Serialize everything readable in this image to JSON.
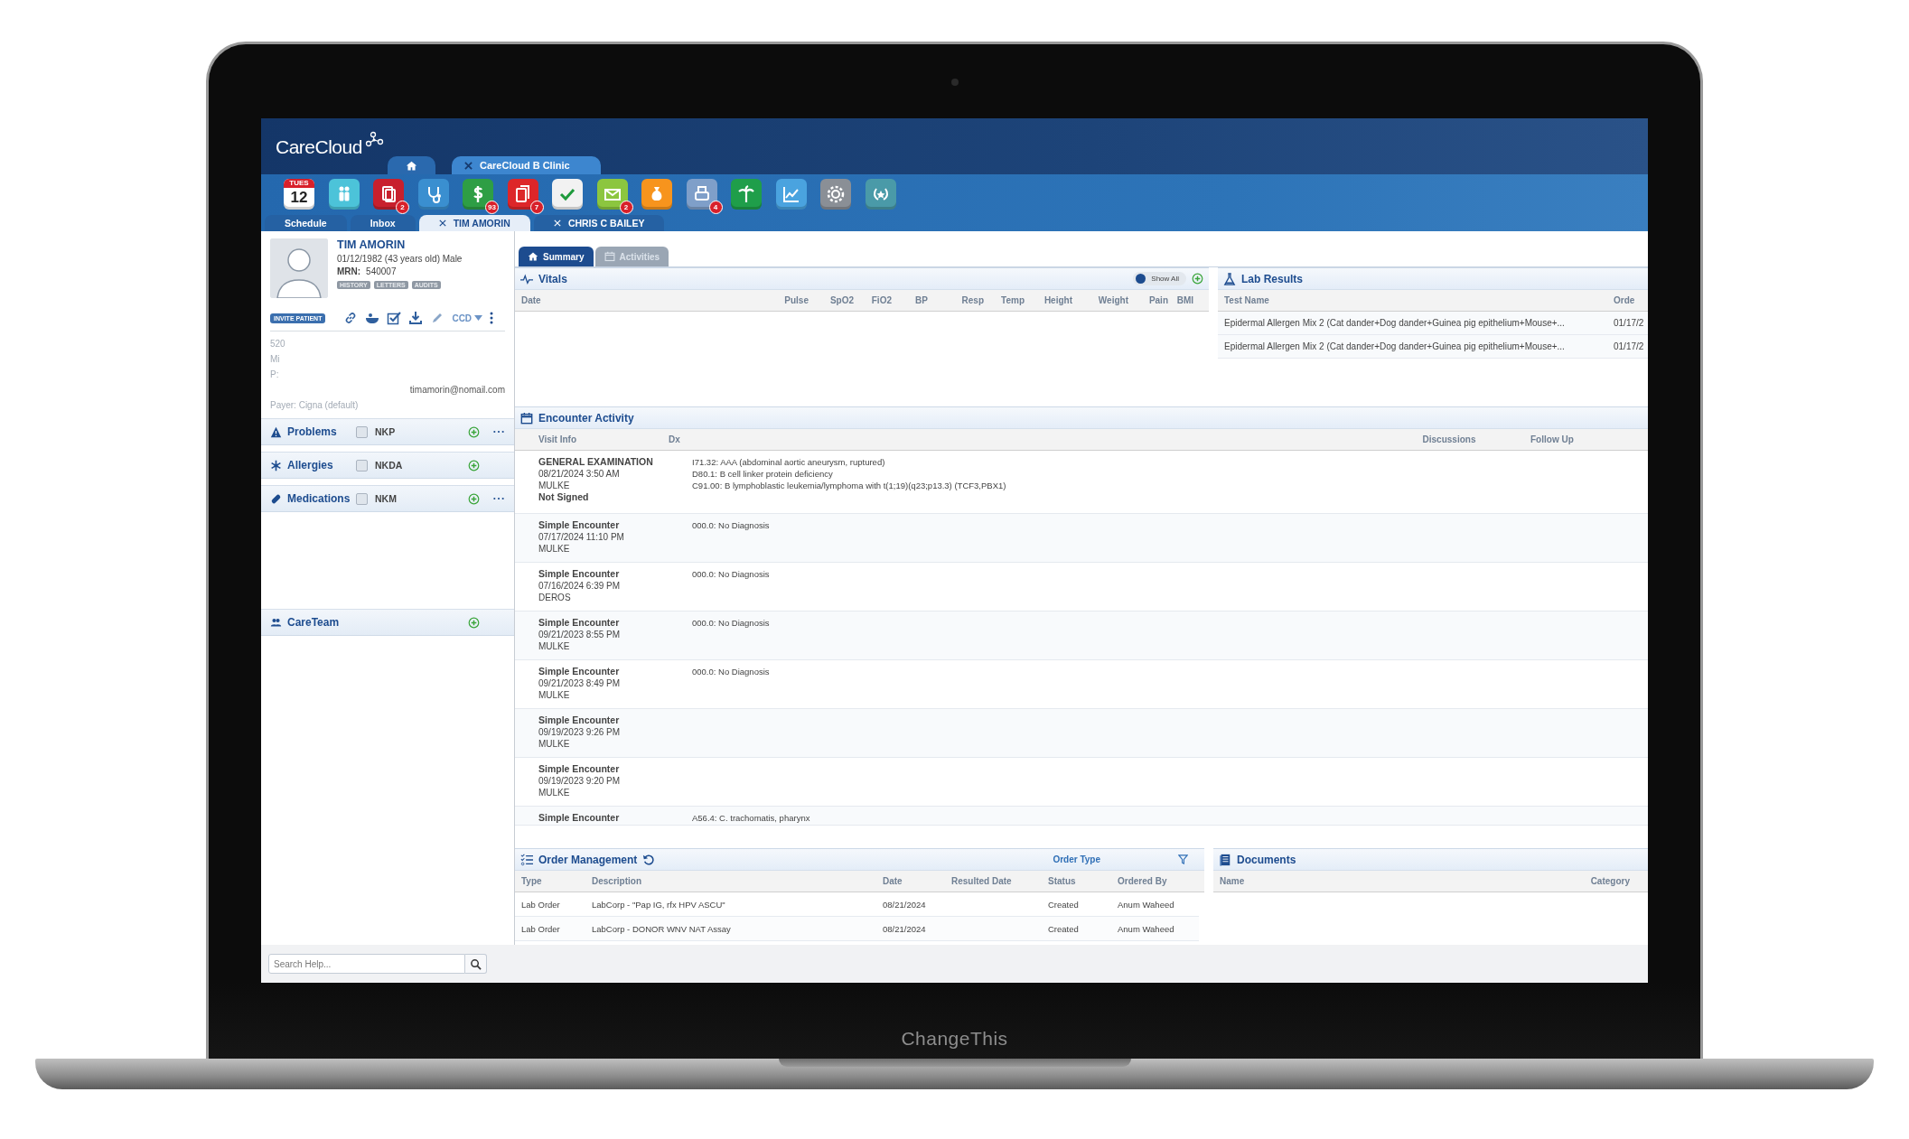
{
  "laptop": {
    "bezel_label": "ChangeThis"
  },
  "header": {
    "logo": "CareCloud",
    "tabs": [
      {
        "kind": "home",
        "selected": false
      },
      {
        "kind": "label",
        "label": "CareCloud B Clinic",
        "closable": true,
        "selected": true
      }
    ]
  },
  "toolbar": {
    "apps": [
      {
        "kind": "calendar",
        "color": "#ffffff",
        "day": "TUES",
        "date": "12"
      },
      {
        "kind": "people",
        "color": "#4cc3d9"
      },
      {
        "kind": "document",
        "color": "#c8202d",
        "badge": "2"
      },
      {
        "kind": "stethoscope",
        "color": "#3a8fd0"
      },
      {
        "kind": "dollar",
        "color": "#2e9e45",
        "badge": "93"
      },
      {
        "kind": "documents",
        "color": "#dd2629",
        "badge": "7"
      },
      {
        "kind": "check",
        "color": "#f2f2f2"
      },
      {
        "kind": "envelope",
        "color": "#8cc63f",
        "badge": "2"
      },
      {
        "kind": "moneybag",
        "color": "#f7941d"
      },
      {
        "kind": "fax",
        "color": "#7f9fc9",
        "badge": "4"
      },
      {
        "kind": "palm",
        "color": "#1f9e4a"
      },
      {
        "kind": "chart",
        "color": "#4aa3df"
      },
      {
        "kind": "gear",
        "color": "#8a8f96"
      },
      {
        "kind": "wreath",
        "color": "#4a9aa8"
      }
    ],
    "tabs": [
      {
        "label": "Schedule",
        "closable": false,
        "selected": false
      },
      {
        "label": "Inbox",
        "closable": false,
        "selected": false
      },
      {
        "label": "TIM AMORIN",
        "closable": true,
        "selected": true
      },
      {
        "label": "CHRIS C BAILEY",
        "closable": true,
        "selected": false
      }
    ]
  },
  "patient": {
    "name": "TIM AMORIN",
    "dob": "01/12/1982 (43 years old) Male",
    "mrn_label": "MRN:",
    "mrn": "540007",
    "badges": [
      "HISTORY",
      "LETTERS",
      "AUDITS"
    ],
    "invite": "INVITE PATIENT",
    "ccd": "CCD",
    "contact_lines": [
      "520",
      "Mi",
      "P:"
    ],
    "email": "timamorin@nomail.com",
    "payer": "Payer: Cigna (default)"
  },
  "sections": [
    {
      "kind": "problems",
      "label": "Problems",
      "none_label": "NKP",
      "checked": false,
      "more": true
    },
    {
      "kind": "allergies",
      "label": "Allergies",
      "none_label": "NKDA",
      "checked": false,
      "more": false
    },
    {
      "kind": "medications",
      "label": "Medications",
      "none_label": "NKM",
      "checked": false,
      "more": true
    }
  ],
  "careteam": {
    "label": "CareTeam"
  },
  "main_tabs": [
    {
      "kind": "home",
      "label": "Summary",
      "selected": true
    },
    {
      "kind": "calendar",
      "label": "Activities",
      "selected": false
    }
  ],
  "vitals": {
    "title": "Vitals",
    "show_all": {
      "label": "Show All",
      "on": false
    },
    "columns": [
      "Date",
      "Pulse",
      "SpO2",
      "FiO2",
      "BP",
      "Resp",
      "Temp",
      "Height",
      "Weight",
      "Pain",
      "BMI"
    ]
  },
  "lab_results": {
    "title": "Lab Results",
    "columns": [
      "Test Name",
      "Orde"
    ],
    "rows": [
      [
        "Epidermal Allergen Mix 2 (Cat dander+Dog dander+Guinea pig epithelium+Mouse+...",
        "01/17/2"
      ],
      [
        "Epidermal Allergen Mix 2 (Cat dander+Dog dander+Guinea pig epithelium+Mouse+...",
        "01/17/2"
      ]
    ]
  },
  "encounters": {
    "title": "Encounter Activity",
    "columns": [
      "Visit Info",
      "Dx",
      "Discussions",
      "Follow Up"
    ],
    "rows": [
      {
        "title": "GENERAL EXAMINATION",
        "lines": [
          "08/21/2024 3:50 AM",
          "MULKE"
        ],
        "status": "Not Signed",
        "dx": [
          "I71.32: AAA (abdominal aortic aneurysm, ruptured)",
          "D80.1: B cell linker protein deficiency",
          "C91.00: B lymphoblastic leukemia/lymphoma with t(1;19)(q23;p13.3) (TCF3,PBX1)"
        ]
      },
      {
        "title": "Simple Encounter",
        "lines": [
          "07/17/2024 11:10 PM",
          "MULKE"
        ],
        "dx": [
          "000.0: No Diagnosis"
        ]
      },
      {
        "title": "Simple Encounter",
        "lines": [
          "07/16/2024 6:39 PM",
          "DEROS"
        ],
        "dx": [
          "000.0: No Diagnosis"
        ]
      },
      {
        "title": "Simple Encounter",
        "lines": [
          "09/21/2023 8:55 PM",
          "MULKE"
        ],
        "dx": [
          "000.0: No Diagnosis"
        ]
      },
      {
        "title": "Simple Encounter",
        "lines": [
          "09/21/2023 8:49 PM",
          "MULKE"
        ],
        "dx": [
          "000.0: No Diagnosis"
        ]
      },
      {
        "title": "Simple Encounter",
        "lines": [
          "09/19/2023 9:26 PM",
          "MULKE"
        ],
        "dx": []
      },
      {
        "title": "Simple Encounter",
        "lines": [
          "09/19/2023 9:20 PM",
          "MULKE"
        ],
        "dx": []
      },
      {
        "title": "Simple Encounter",
        "lines": [],
        "dx": [
          "A56.4: C. trachomatis, pharynx"
        ]
      }
    ]
  },
  "orders": {
    "title": "Order Management",
    "filter_label": "Order Type",
    "columns": [
      "Type",
      "Description",
      "Date",
      "Resulted Date",
      "Status",
      "Ordered By"
    ],
    "rows": [
      [
        "Lab Order",
        "LabCorp - \"Pap IG, rfx HPV ASCU\"",
        "08/21/2024",
        "",
        "Created",
        "Anum Waheed"
      ],
      [
        "Lab Order",
        "LabCorp - DONOR WNV NAT Assay",
        "08/21/2024",
        "",
        "Created",
        "Anum Waheed"
      ]
    ]
  },
  "documents": {
    "title": "Documents",
    "columns": [
      "Name",
      "Category"
    ]
  },
  "help_search": {
    "placeholder": "Search Help..."
  }
}
